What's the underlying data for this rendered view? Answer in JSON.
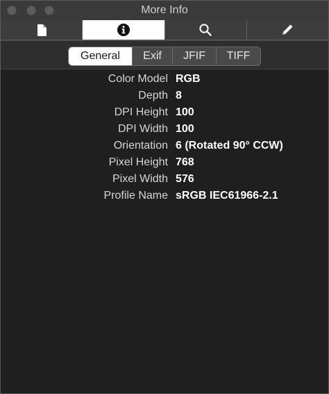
{
  "window": {
    "title": "More Info"
  },
  "toolbar": {
    "tabs": [
      {
        "icon": "document-icon",
        "active": false
      },
      {
        "icon": "info-icon",
        "active": true
      },
      {
        "icon": "search-icon",
        "active": false
      },
      {
        "icon": "pencil-icon",
        "active": false
      }
    ]
  },
  "segments": {
    "items": [
      "General",
      "Exif",
      "JFIF",
      "TIFF"
    ],
    "selected": "General"
  },
  "properties": [
    {
      "key": "Color Model",
      "value": "RGB"
    },
    {
      "key": "Depth",
      "value": "8"
    },
    {
      "key": "DPI Height",
      "value": "100"
    },
    {
      "key": "DPI Width",
      "value": "100"
    },
    {
      "key": "Orientation",
      "value": "6 (Rotated 90° CCW)"
    },
    {
      "key": "Pixel Height",
      "value": "768"
    },
    {
      "key": "Pixel Width",
      "value": "576"
    },
    {
      "key": "Profile Name",
      "value": "sRGB IEC61966-2.1"
    }
  ]
}
